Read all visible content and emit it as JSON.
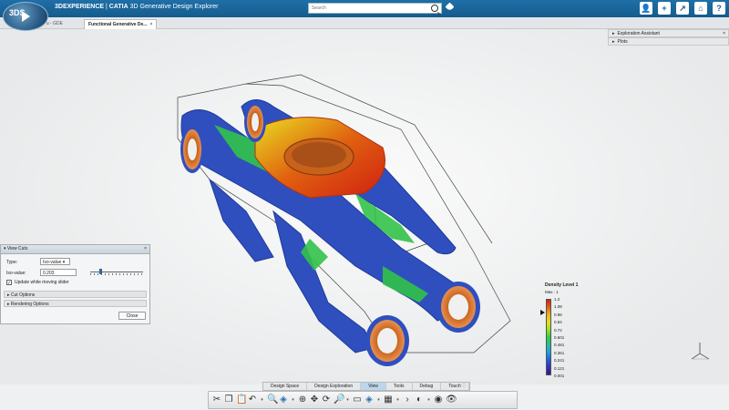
{
  "app": {
    "brand": "3DEXPERIENCE",
    "separator": " | ",
    "product": "CATIA",
    "title": " 3D Generative Design Explorer",
    "compass_logo": "3DS"
  },
  "search": {
    "placeholder": "Search"
  },
  "top_icons": [
    "user-icon",
    "add-icon",
    "share-icon",
    "home-icon",
    "help-icon"
  ],
  "top_icon_glyphs": [
    "👤",
    "+",
    "↗",
    "⌂",
    "?"
  ],
  "tabs": [
    {
      "label": "b l e u - GDE"
    },
    {
      "label": "Functional Generative De...",
      "close": "×"
    }
  ],
  "right_panels": [
    {
      "label": "Exploration Assistant",
      "arrow": "▸",
      "close": "×"
    },
    {
      "label": "Plots",
      "arrow": "▸"
    }
  ],
  "view_cuts": {
    "title": "View Cuts",
    "title_arrow": "▾",
    "close": "×",
    "type_label": "Type:",
    "type_value": "Iso-value",
    "iso_label": "Iso-value:",
    "iso_value": "0.203",
    "update_label": "Update while moving slider",
    "update_checked": "✓",
    "cut_options": "Cut Options",
    "rendering_options": "Rendering Options",
    "section_arrow": "▸",
    "close_button": "Close"
  },
  "density_legend": {
    "title": "Density Level 1",
    "max_label": "Max : 1",
    "labels": [
      "1.2",
      "1.08",
      "0.96",
      "0.84",
      "0.72",
      "0.601",
      "0.481",
      "0.361",
      "0.241",
      "0.121",
      "0.001"
    ]
  },
  "bottom_tabs": [
    {
      "label": "Design Space",
      "active": false
    },
    {
      "label": "Design Exploration",
      "active": false
    },
    {
      "label": "View",
      "active": true
    },
    {
      "label": "Tools",
      "active": false
    },
    {
      "label": "Debug",
      "active": false
    },
    {
      "label": "Touch",
      "active": false
    }
  ],
  "bottom_tabs_extra": "♡",
  "action_bar": [
    {
      "name": "cut-icon",
      "glyph": "✂"
    },
    {
      "name": "copy-icon",
      "glyph": "❐"
    },
    {
      "name": "paste-icon",
      "glyph": "📋"
    },
    {
      "name": "undo-icon",
      "glyph": "↶"
    },
    {
      "name": "dropdown-icon",
      "glyph": "▾",
      "small": true
    },
    {
      "name": "zoom-icon",
      "glyph": "🔍"
    },
    {
      "name": "cube-view-icon",
      "glyph": "◈",
      "blue": true
    },
    {
      "name": "dropdown-icon",
      "glyph": "▾",
      "small": true
    },
    {
      "name": "target-icon",
      "glyph": "⊕"
    },
    {
      "name": "pan-icon",
      "glyph": "✥"
    },
    {
      "name": "rotate-icon",
      "glyph": "⟳"
    },
    {
      "name": "zoom-area-icon",
      "glyph": "🔎"
    },
    {
      "name": "dropdown-icon",
      "glyph": "▾",
      "small": true
    },
    {
      "name": "normal-view-icon",
      "glyph": "▭"
    },
    {
      "name": "iso-view-icon",
      "glyph": "◈",
      "blue": true
    },
    {
      "name": "dropdown-icon",
      "glyph": "▾",
      "small": true
    },
    {
      "name": "render-style-icon",
      "glyph": "▦"
    },
    {
      "name": "dropdown-icon",
      "glyph": "▾",
      "small": true
    },
    {
      "name": "more-icon",
      "glyph": "›"
    },
    {
      "name": "hide-show-icon",
      "glyph": "◐"
    },
    {
      "name": "dropdown-icon",
      "glyph": "▾",
      "small": true
    },
    {
      "name": "visibility-icon",
      "glyph": "◉"
    },
    {
      "name": "swap-visible-icon",
      "glyph": "👁"
    }
  ],
  "colors": {
    "topbar": "#1f6fa8",
    "high_density": "#d02010",
    "low_density": "#2a3fb0",
    "bushing": "#c8621a"
  }
}
